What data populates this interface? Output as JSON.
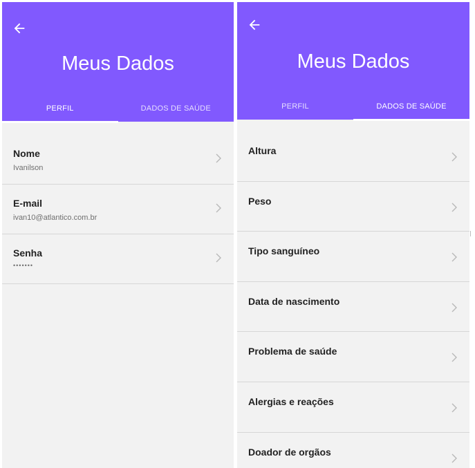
{
  "left_screen": {
    "title": "Meus Dados",
    "tabs": [
      {
        "label": "PERFIL",
        "active": true
      },
      {
        "label": "DADOS DE SAÚDE",
        "active": false
      }
    ],
    "items": [
      {
        "label": "Nome",
        "value": "Ivanilson"
      },
      {
        "label": "E-mail",
        "value": "ivan10@atlantico.com.br"
      },
      {
        "label": "Senha",
        "value": "•••••••"
      }
    ]
  },
  "right_screen": {
    "title": "Meus Dados",
    "tabs": [
      {
        "label": "PERFIL",
        "active": false
      },
      {
        "label": "DADOS DE SAÚDE",
        "active": true
      }
    ],
    "items": [
      {
        "label": "Altura"
      },
      {
        "label": "Peso"
      },
      {
        "label": "Tipo sanguíneo"
      },
      {
        "label": "Data de nascimento"
      },
      {
        "label": "Problema de saúde"
      },
      {
        "label": "Alergias e reações"
      },
      {
        "label": "Doador de orgãos"
      }
    ]
  },
  "icons": {
    "back": "arrow-left-icon",
    "row": "chevron-right-icon"
  },
  "colors": {
    "header": "#8159fe",
    "background": "#f2f2f2",
    "divider": "#d6d6d6",
    "text_primary": "#222222",
    "text_secondary": "#6f6f6f"
  }
}
